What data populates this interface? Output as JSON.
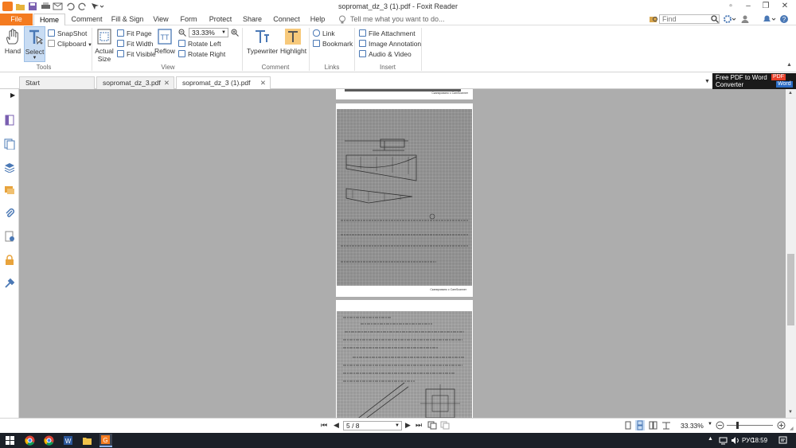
{
  "window": {
    "title": "sopromat_dz_3 (1).pdf - Foxit Reader"
  },
  "menu": {
    "file": "File",
    "tabs": [
      "Home",
      "Comment",
      "Fill & Sign",
      "View",
      "Form",
      "Protect",
      "Share",
      "Connect",
      "Help"
    ],
    "active": "Home",
    "tell_me": "Tell me what you want to do...",
    "find_placeholder": "Find"
  },
  "ribbon": {
    "tools": {
      "hand": "Hand",
      "select": "Select",
      "snapshot": "SnapShot",
      "clipboard": "Clipboard",
      "label": "Tools"
    },
    "view": {
      "actual_size_1": "Actual",
      "actual_size_2": "Size",
      "fit_page": "Fit Page",
      "fit_width": "Fit Width",
      "fit_visible": "Fit Visible",
      "reflow": "Reflow",
      "zoom": "33.33%",
      "rotate_left": "Rotate Left",
      "rotate_right": "Rotate Right",
      "label": "View"
    },
    "comment": {
      "typewriter": "Typewriter",
      "highlight": "Highlight",
      "label": "Comment"
    },
    "links": {
      "link": "Link",
      "bookmark": "Bookmark",
      "label": "Links"
    },
    "insert": {
      "file_attachment": "File Attachment",
      "image_annotation": "Image Annotation",
      "audio_video": "Audio & Video",
      "label": "Insert"
    }
  },
  "tabs": [
    {
      "label": "Start",
      "closable": false
    },
    {
      "label": "sopromat_dz_3.pdf",
      "closable": true
    },
    {
      "label": "sopromat_dz_3 (1).pdf",
      "closable": true
    }
  ],
  "promo": {
    "line1": "Free PDF to Word",
    "line2": "Converter",
    "badge1": "PDF",
    "badge2": "Word"
  },
  "pages": [
    {
      "footer": "Сканировано с CamScanner"
    },
    {
      "footer": "Сканировано с CamScanner"
    }
  ],
  "statusbar": {
    "page": "5 / 8",
    "zoom": "33.33%"
  },
  "taskbar": {
    "lang": "РУС",
    "time": "18:59"
  },
  "colors": {
    "accent": "#f47b20",
    "doc_bg": "#adadad",
    "taskbar": "#1b2028",
    "icon_blue": "#4a78b5"
  }
}
